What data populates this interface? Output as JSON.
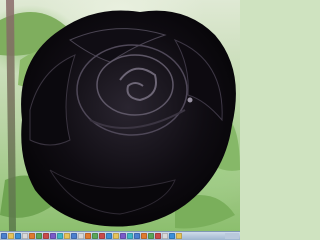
{
  "wallpaper": {
    "subject": "black-rose-photo",
    "colors": {
      "petal_dark": "#050407",
      "petal_mid": "#1a1620",
      "petal_highlight": "#6d6676",
      "leaf": "#7fae5e",
      "background": "#cfe3c0"
    }
  },
  "taskbar": {
    "buttons": [
      {
        "icon": "start-icon",
        "color": "#4a7fcf"
      },
      {
        "icon": "folder-icon",
        "color": "#e6c35a"
      },
      {
        "icon": "browser-icon",
        "color": "#3b8ed8"
      },
      {
        "icon": "mail-icon",
        "color": "#d9d9d9"
      },
      {
        "icon": "media-icon",
        "color": "#e07a2f"
      },
      {
        "icon": "app-icon",
        "color": "#5aa65a"
      },
      {
        "icon": "app-icon",
        "color": "#c94a4a"
      },
      {
        "icon": "app-icon",
        "color": "#7a5ac9"
      },
      {
        "icon": "app-icon",
        "color": "#3fb7c4"
      },
      {
        "icon": "app-icon",
        "color": "#e6c35a"
      },
      {
        "icon": "app-icon",
        "color": "#4a7fcf"
      },
      {
        "icon": "app-icon",
        "color": "#d9d9d9"
      },
      {
        "icon": "app-icon",
        "color": "#e07a2f"
      },
      {
        "icon": "app-icon",
        "color": "#5aa65a"
      },
      {
        "icon": "app-icon",
        "color": "#c94a4a"
      },
      {
        "icon": "app-icon",
        "color": "#3b8ed8"
      },
      {
        "icon": "app-icon",
        "color": "#e6c35a"
      },
      {
        "icon": "app-icon",
        "color": "#7a5ac9"
      },
      {
        "icon": "app-icon",
        "color": "#3fb7c4"
      },
      {
        "icon": "app-icon",
        "color": "#4a7fcf"
      },
      {
        "icon": "app-icon",
        "color": "#e07a2f"
      },
      {
        "icon": "app-icon",
        "color": "#5aa65a"
      },
      {
        "icon": "app-icon",
        "color": "#c94a4a"
      },
      {
        "icon": "app-icon",
        "color": "#d9d9d9"
      },
      {
        "icon": "app-icon",
        "color": "#3b8ed8"
      },
      {
        "icon": "app-icon",
        "color": "#e6c35a"
      }
    ]
  }
}
